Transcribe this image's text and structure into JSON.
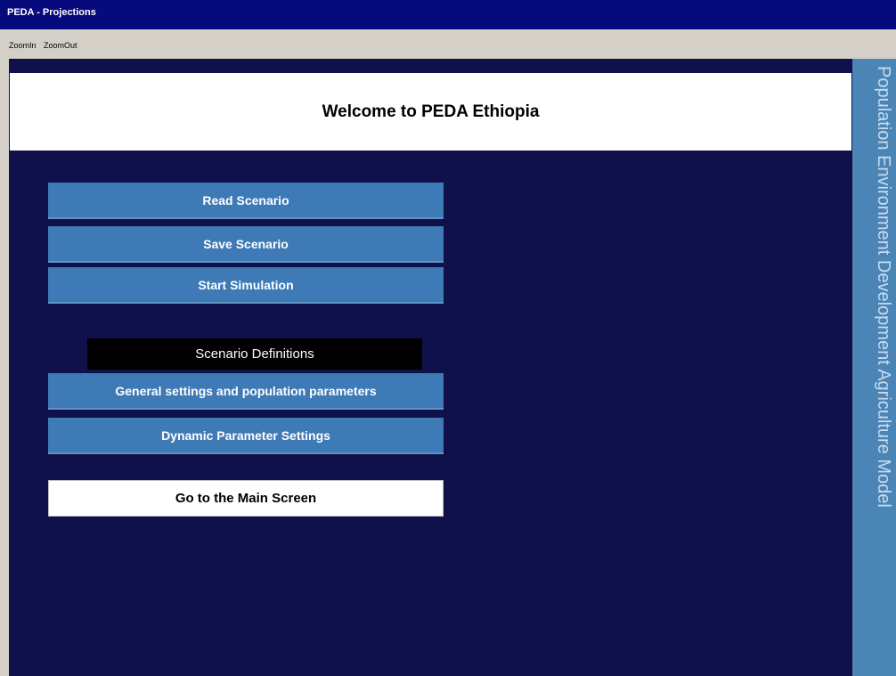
{
  "window": {
    "title": "PEDA - Projections"
  },
  "menu": {
    "items": [
      {
        "label": "ZoomIn"
      },
      {
        "label": "ZoomOut"
      }
    ]
  },
  "header": {
    "title": "Welcome to PEDA Ethiopia"
  },
  "side_banner": {
    "text": "Population Environment Development Agriculture Model"
  },
  "actions": {
    "read_scenario": "Read Scenario",
    "save_scenario": "Save Scenario",
    "start_simulation": "Start Simulation"
  },
  "scenario_definitions": {
    "label": "Scenario Definitions",
    "general_settings": "General settings and population parameters",
    "dynamic_settings": "Dynamic Parameter Settings"
  },
  "navigation": {
    "main_screen": "Go to the Main Screen"
  },
  "colors": {
    "title_bar": "#060a7c",
    "background": "#10114a",
    "button": "#3e7ab6",
    "side_banner": "#4a85b5"
  }
}
